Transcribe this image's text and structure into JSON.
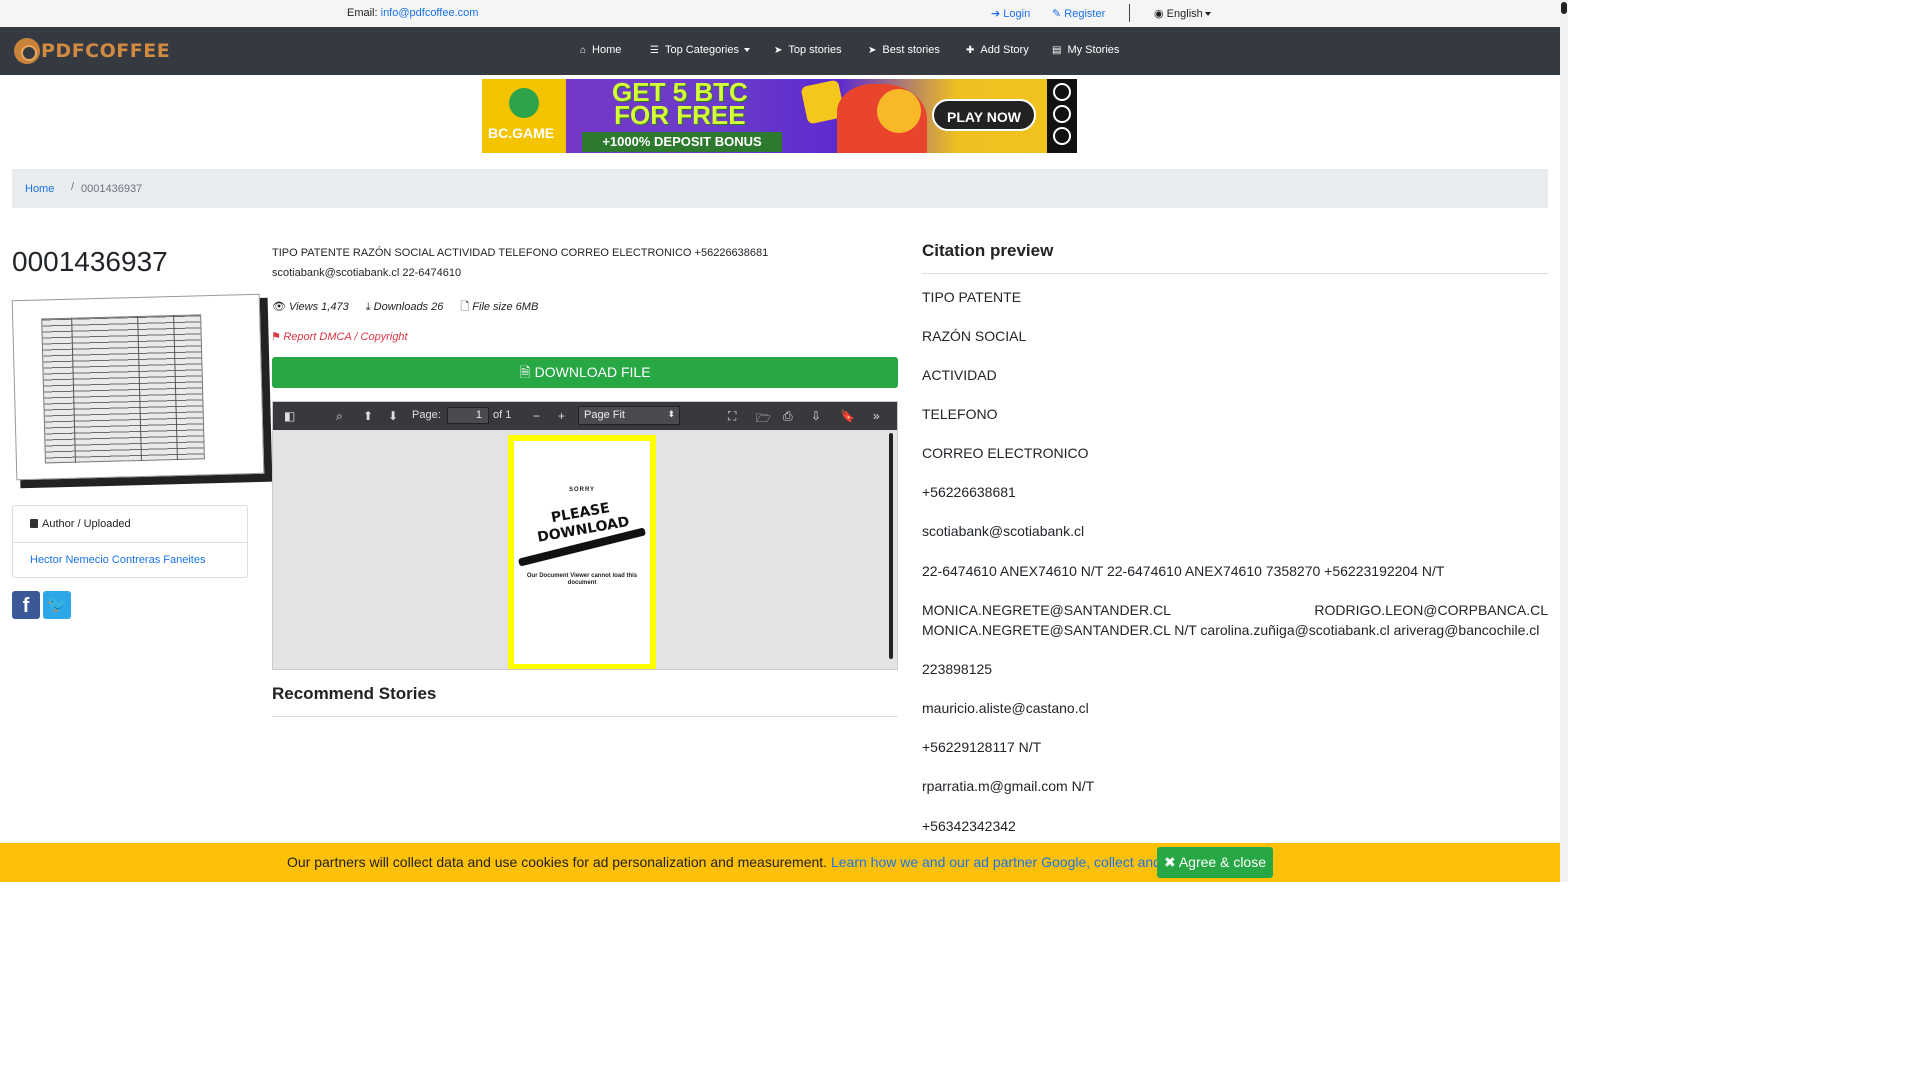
{
  "topbar": {
    "email_label": "Email:",
    "email": "info@pdfcoffee.com",
    "login": "Login",
    "register": "Register",
    "language": "English"
  },
  "navbar": {
    "logo": "PDFCOFFEE",
    "items": [
      {
        "label": "Home",
        "icon": "home-icon"
      },
      {
        "label": "Top Categories",
        "icon": "list-icon"
      },
      {
        "label": "Top stories",
        "icon": "paper-plane-icon"
      },
      {
        "label": "Best stories",
        "icon": "paper-plane-icon"
      },
      {
        "label": "Add Story",
        "icon": "plus-icon"
      },
      {
        "label": "My Stories",
        "icon": "file-icon"
      }
    ]
  },
  "banner": {
    "brand": "BC.GAME",
    "headline_1": "GET 5 BTC",
    "headline_2": "FOR FREE",
    "bonus": "+1000% DEPOSIT BONUS",
    "cta": "PLAY NOW"
  },
  "breadcrumb": {
    "home": "Home",
    "current": "0001436937"
  },
  "document": {
    "title": "0001436937",
    "description": "TIPO PATENTE RAZÓN SOCIAL ACTIVIDAD TELEFONO CORREO ELECTRONICO +56226638681 scotiabank@scotiabank.cl 22-6474610",
    "views": "Views 1,473",
    "downloads": "Downloads 26",
    "file_size": "File size 6MB",
    "report": "Report DMCA / Copyright",
    "download_button": "DOWNLOAD FILE",
    "author_header": "Author / Uploaded",
    "author": "Hector Nemecio Contreras Faneites"
  },
  "viewer": {
    "page_label": "Page:",
    "page_value": "1",
    "page_of": "of 1",
    "zoom": "Page Fit",
    "sorry": "SORRY",
    "please_download_1": "PLEASE",
    "please_download_2": "DOWNLOAD",
    "message": "Our Document Viewer cannot load this document"
  },
  "recommend": {
    "title": "Recommend Stories"
  },
  "citation": {
    "title": "Citation preview",
    "lines": [
      "TIPO PATENTE",
      "RAZÓN SOCIAL",
      "ACTIVIDAD",
      "TELEFONO",
      "CORREO ELECTRONICO",
      "+56226638681",
      "scotiabank@scotiabank.cl",
      "22-6474610 ANEX74610 N/T 22-6474610 ANEX74610 7358270 +56223192204 N/T",
      "MONICA.NEGRETE@SANTANDER.CL",
      "RODRIGO.LEON@CORPBANCA.CL",
      "MONICA.NEGRETE@SANTANDER.CL N/T carolina.zuñiga@scotiabank.cl ariverag@bancochile.cl",
      "223898125",
      "mauricio.aliste@castano.cl",
      "+56229128117 N/T",
      "rparratia.m@gmail.com N/T",
      "+56342342342"
    ]
  },
  "cookie": {
    "text": "Our partners will collect data and use cookies for ad personalization and measurement.",
    "link": "Learn how we and our ad partner Google, collect and use data",
    "period": ".",
    "button": "Agree & close"
  },
  "colors": {
    "navbar": "#343a40",
    "link": "#1a73e8",
    "download_button": "#28a745",
    "cookie_bar": "#ffc107",
    "report": "#dc3545"
  }
}
